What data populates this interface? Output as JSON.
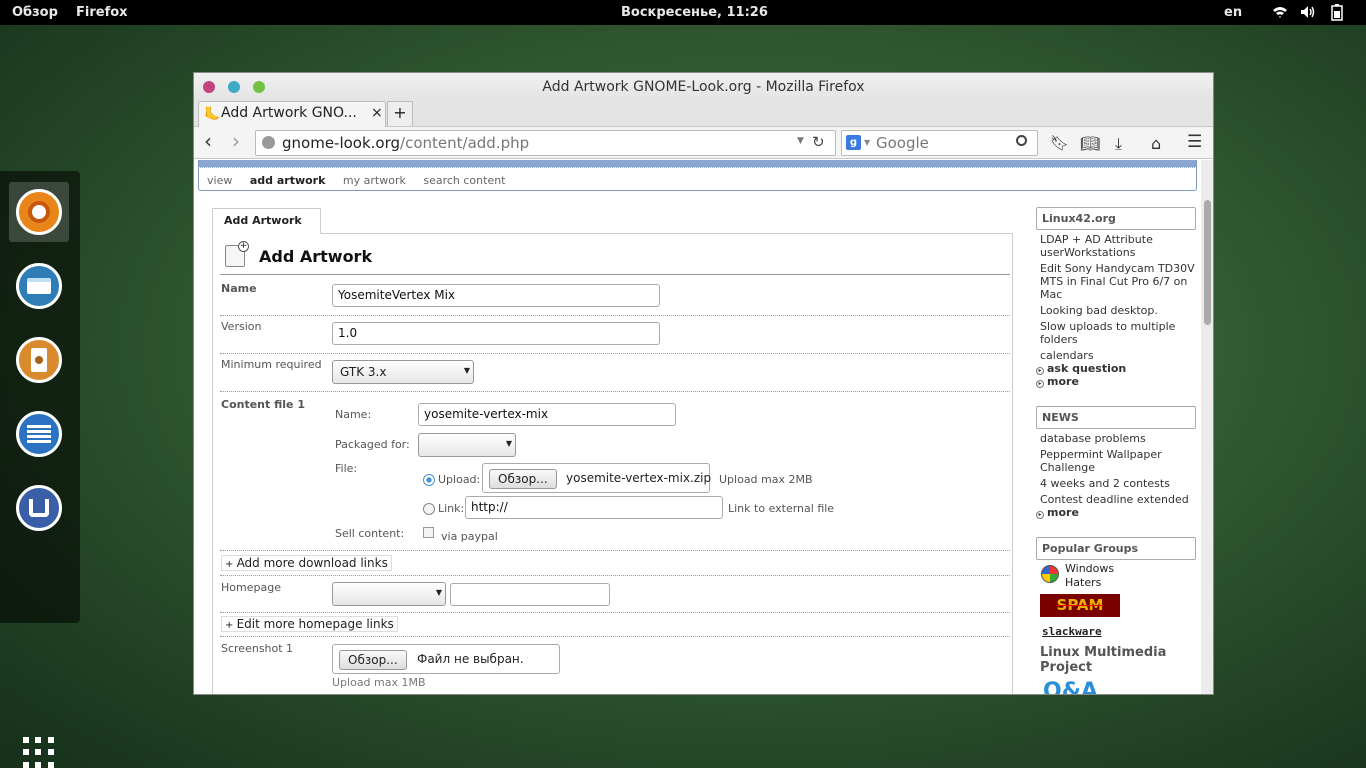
{
  "topbar": {
    "activities": "Обзор",
    "app": "Firefox",
    "clock": "Воскресенье, 11:26",
    "lang": "en"
  },
  "dock": {
    "items": [
      "firefox-icon",
      "files-icon",
      "music-player-icon",
      "document-viewer-icon",
      "software-center-icon"
    ],
    "show_apps": "apps-grid-icon"
  },
  "window": {
    "title": "Add  Artwork GNOME-Look.org - Mozilla Firefox",
    "tab_title": "Add  Artwork GNO...",
    "tab_close": "×",
    "new_tab": "+"
  },
  "navbar": {
    "url_host": "gnome-look.org",
    "url_path": "/content/add.php",
    "search_placeholder": "Google"
  },
  "site": {
    "submenu": [
      "view",
      "add artwork",
      "my artwork",
      "search content"
    ],
    "tab_label": "Add  Artwork",
    "page_title": "Add  Artwork",
    "form": {
      "name_label": "Name",
      "name_value": "YosemiteVertex Mix",
      "version_label": "Version",
      "version_value": "1.0",
      "minreq_label": "Minimum required",
      "minreq_value": "GTK 3.x",
      "content_label": "Content file 1",
      "cf_name_label": "Name:",
      "cf_name_value": "yosemite-vertex-mix",
      "packaged_label": "Packaged for:",
      "file_label": "File:",
      "upload_label": "Upload:",
      "browse_label": "Обзор...",
      "file_name": "yosemite-vertex-mix.zip",
      "upload_max": "Upload max 2MB",
      "link_label": "Link:",
      "link_value": "http://",
      "link_hint": "Link to external file",
      "sell_label": "Sell content:",
      "sell_hint": "via paypal",
      "add_links": "Add more download links",
      "homepage_label": "Homepage",
      "edit_homepage": "Edit more homepage links",
      "screenshot_label": "Screenshot 1",
      "no_file": "Файл не выбран.",
      "upload_max_ss": "Upload max 1MB"
    },
    "sidebar": {
      "linux42": {
        "title": "Linux42.org",
        "items": [
          "LDAP + AD Attribute userWorkstations",
          "Edit Sony Handycam TD30V MTS in Final Cut Pro 6/7 on Mac",
          "Looking bad desktop.",
          "Slow uploads to multiple folders",
          "calendars"
        ],
        "ask": "ask question",
        "more": "more"
      },
      "news": {
        "title": "NEWS",
        "items": [
          "database problems",
          "Peppermint Wallpaper Challenge",
          "4 weeks and 2 contests",
          "Contest deadline extended"
        ],
        "more": "more"
      },
      "groups": {
        "title": "Popular Groups",
        "windows_haters": "Windows Haters",
        "spam": "SPAM",
        "slackware": "slackware",
        "multimedia": "Linux Multimedia Project",
        "qa": "Q&A"
      }
    }
  },
  "colors": {
    "menu_blue": "#8aa6d1",
    "close_red": "#c2447e",
    "min_teal": "#3fa9c6",
    "max_green": "#74c043",
    "accent_orange": "#e8861a"
  }
}
